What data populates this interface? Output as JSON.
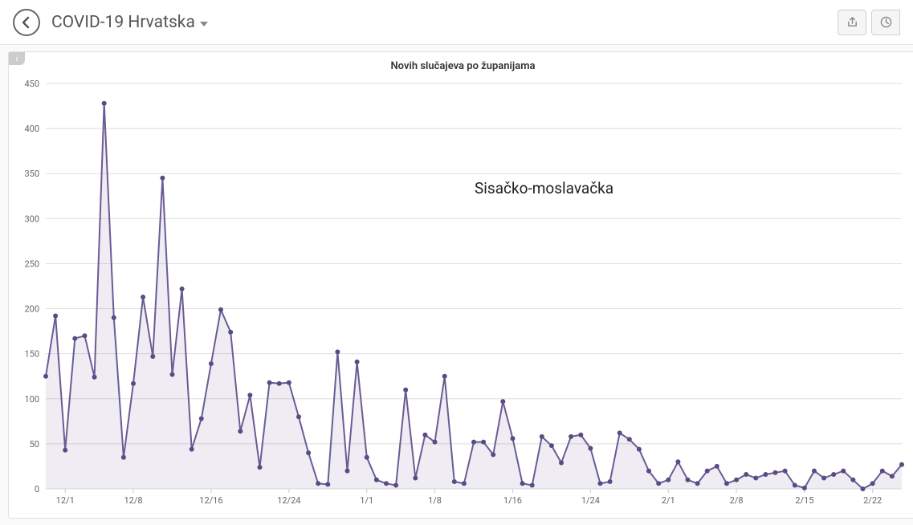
{
  "header": {
    "title": "COVID-19 Hrvatska"
  },
  "chart_data": {
    "type": "area",
    "title": "Novih slučajeva po županijama",
    "series_name": "Sisačko-moslavačka",
    "ylabel": "",
    "xlabel": "",
    "ylim": [
      0,
      450
    ],
    "yticks": [
      0,
      50,
      100,
      150,
      200,
      250,
      300,
      350,
      400,
      450
    ],
    "xticks": [
      "12/1",
      "12/8",
      "12/16",
      "12/24",
      "1/1",
      "1/8",
      "1/16",
      "1/24",
      "2/1",
      "2/8",
      "2/15",
      "2/22"
    ],
    "dates": [
      "11/29",
      "11/30",
      "12/1",
      "12/2",
      "12/3",
      "12/4",
      "12/5",
      "12/6",
      "12/7",
      "12/8",
      "12/9",
      "12/10",
      "12/11",
      "12/12",
      "12/13",
      "12/14",
      "12/15",
      "12/16",
      "12/17",
      "12/18",
      "12/19",
      "12/20",
      "12/21",
      "12/22",
      "12/23",
      "12/24",
      "12/25",
      "12/26",
      "12/27",
      "12/28",
      "12/29",
      "12/30",
      "12/31",
      "1/1",
      "1/2",
      "1/3",
      "1/4",
      "1/5",
      "1/6",
      "1/7",
      "1/8",
      "1/9",
      "1/10",
      "1/11",
      "1/12",
      "1/13",
      "1/14",
      "1/15",
      "1/16",
      "1/17",
      "1/18",
      "1/19",
      "1/20",
      "1/21",
      "1/22",
      "1/23",
      "1/24",
      "1/25",
      "1/26",
      "1/27",
      "1/28",
      "1/29",
      "1/30",
      "1/31",
      "2/1",
      "2/2",
      "2/3",
      "2/4",
      "2/5",
      "2/6",
      "2/7",
      "2/8",
      "2/9",
      "2/10",
      "2/11",
      "2/12",
      "2/13",
      "2/14",
      "2/15",
      "2/16",
      "2/17",
      "2/18",
      "2/19",
      "2/20",
      "2/21",
      "2/22",
      "2/23",
      "2/24",
      "2/25"
    ],
    "values": [
      125,
      192,
      43,
      167,
      170,
      124,
      428,
      190,
      35,
      117,
      213,
      147,
      345,
      127,
      222,
      44,
      78,
      139,
      199,
      174,
      64,
      104,
      24,
      118,
      117,
      118,
      80,
      40,
      6,
      5,
      152,
      20,
      141,
      35,
      10,
      6,
      4,
      110,
      12,
      60,
      52,
      125,
      8,
      6,
      52,
      52,
      38,
      97,
      56,
      6,
      4,
      58,
      48,
      29,
      58,
      60,
      45,
      6,
      8,
      62,
      55,
      44,
      20,
      6,
      10,
      30,
      10,
      6,
      20,
      25,
      6,
      10,
      16,
      12,
      16,
      18,
      20,
      4,
      1,
      20,
      12,
      16,
      20,
      10,
      0,
      6,
      20,
      14,
      27
    ]
  }
}
